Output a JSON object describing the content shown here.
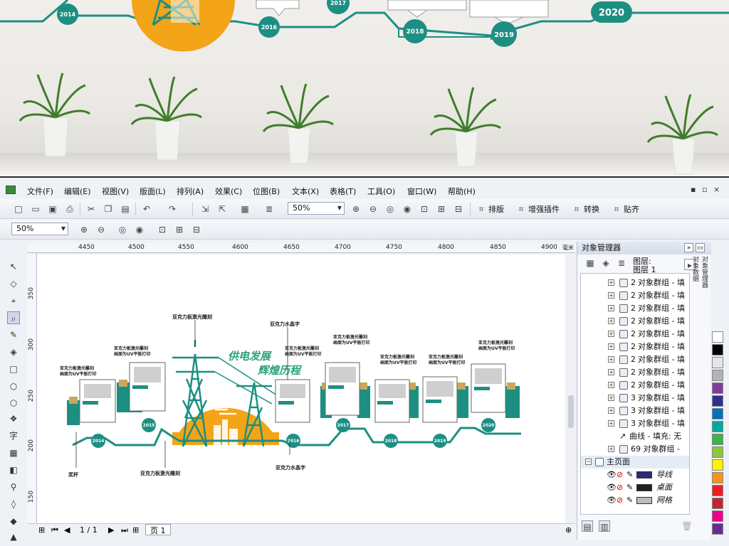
{
  "photo": {
    "years": [
      "2014",
      "2016",
      "2017",
      "2018",
      "2019",
      "2020"
    ],
    "colors": {
      "teal": "#1d8f82",
      "orange": "#f3a417",
      "wall": "#ebe9e4"
    }
  },
  "menubar": {
    "items": [
      "文件(F)",
      "编辑(E)",
      "视图(V)",
      "版面(L)",
      "排列(A)",
      "效果(C)",
      "位图(B)",
      "文本(X)",
      "表格(T)",
      "工具(O)",
      "窗口(W)",
      "帮助(H)"
    ]
  },
  "toolbar1": {
    "zoom": "50%",
    "layout_label": "排版",
    "plugins_label": "增强插件",
    "convert_label": "转换",
    "snap_label": "贴齐"
  },
  "toolbar2": {
    "zoom": "50%"
  },
  "ruler": {
    "h_ticks": [
      "4450",
      "4500",
      "4550",
      "4600",
      "4650",
      "4700",
      "4750",
      "4800",
      "4850",
      "4900"
    ],
    "h_unit": "毫米",
    "v_ticks": [
      "350",
      "300",
      "250",
      "200",
      "150"
    ]
  },
  "design": {
    "title1": "供电发展",
    "title2": "辉煌历程",
    "years": [
      "2014",
      "2015",
      "2016",
      "2017",
      "2018",
      "2019",
      "2020"
    ],
    "annot_acrylic_laser": "亚克力板激光雕刻",
    "annot_uv": "画面为UV平板打印",
    "annot_crystal": "亚克力水晶字",
    "annot_trophy": "奖杯",
    "card_tag": "辉煌历程",
    "colors": {
      "teal": "#1d8f82",
      "orange": "#f3a417",
      "cream": "#f5eed6",
      "green": "#2aa37a"
    }
  },
  "status": {
    "page_counter": "1 / 1",
    "page_tab": "页 1"
  },
  "object_manager": {
    "title": "对象管理器",
    "layer_label": "图层:",
    "layer_name": "图层 1",
    "rows": [
      {
        "count": "2",
        "label": "对象群组 - 填"
      },
      {
        "count": "2",
        "label": "对象群组 - 填"
      },
      {
        "count": "2",
        "label": "对象群组 - 填"
      },
      {
        "count": "2",
        "label": "对象群组 - 填"
      },
      {
        "count": "2",
        "label": "对象群组 - 填"
      },
      {
        "count": "2",
        "label": "对象群组 - 填"
      },
      {
        "count": "2",
        "label": "对象群组 - 填"
      },
      {
        "count": "2",
        "label": "对象群组 - 填"
      },
      {
        "count": "2",
        "label": "对象群组 - 填"
      },
      {
        "count": "3",
        "label": "对象群组 - 填"
      },
      {
        "count": "3",
        "label": "对象群组 - 填"
      },
      {
        "count": "3",
        "label": "对象群组 - 填"
      }
    ],
    "curve_row": "曲线 - 填充: 无",
    "group69_row": "69 对象群组 -",
    "master_page": "主页面",
    "guides": "导线",
    "desktop": "桌面",
    "grid": "网格",
    "side_tab1": "对象管理器",
    "side_tab2": "对象数据"
  },
  "palette": [
    "#ffffff",
    "#000000",
    "#e6e6e6",
    "#b3b3b3",
    "#7f3f98",
    "#2e3192",
    "#0071bc",
    "#00a99d",
    "#39b54a",
    "#8cc63f",
    "#fff200",
    "#f7931e",
    "#ed1c24",
    "#c1272d",
    "#ec008c",
    "#662d91"
  ]
}
